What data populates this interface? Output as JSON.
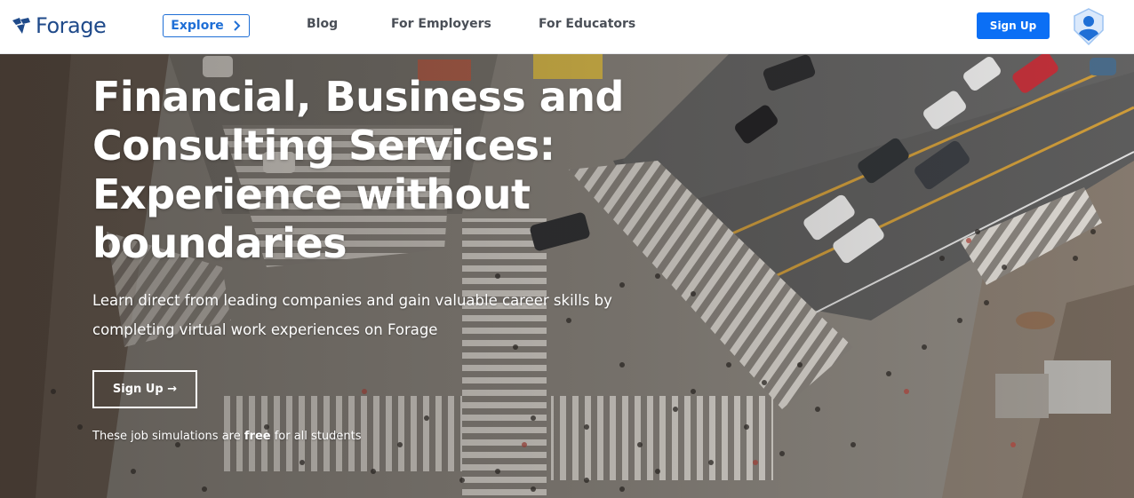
{
  "header": {
    "logo_text": "Forage",
    "explore_label": "Explore",
    "nav": {
      "blog": "Blog",
      "employers": "For Employers",
      "educators": "For Educators"
    },
    "signup_label": "Sign Up",
    "icons": {
      "logo": "forage-logo-icon",
      "explore_arrow": "chevron-right-icon",
      "avatar": "user-avatar-icon"
    }
  },
  "hero": {
    "title_lines": [
      "Financial, Business and",
      "Consulting Services:",
      "Experience without",
      "boundaries"
    ],
    "subtitle_lines": [
      "Learn direct from leading companies and gain valuable career skills by",
      "completing virtual work experiences on Forage"
    ],
    "cta_label": "Sign Up →",
    "note_prefix": "These job simulations are ",
    "note_bold": "free",
    "note_suffix": " for all students",
    "background": "aerial-city-crosswalk-photo"
  },
  "colors": {
    "brand_navy": "#1f4a8a",
    "brand_blue": "#0b6ff5",
    "explore_blue": "#1f6fd6",
    "nav_text": "#4a4f57",
    "hero_text": "#ffffff"
  }
}
